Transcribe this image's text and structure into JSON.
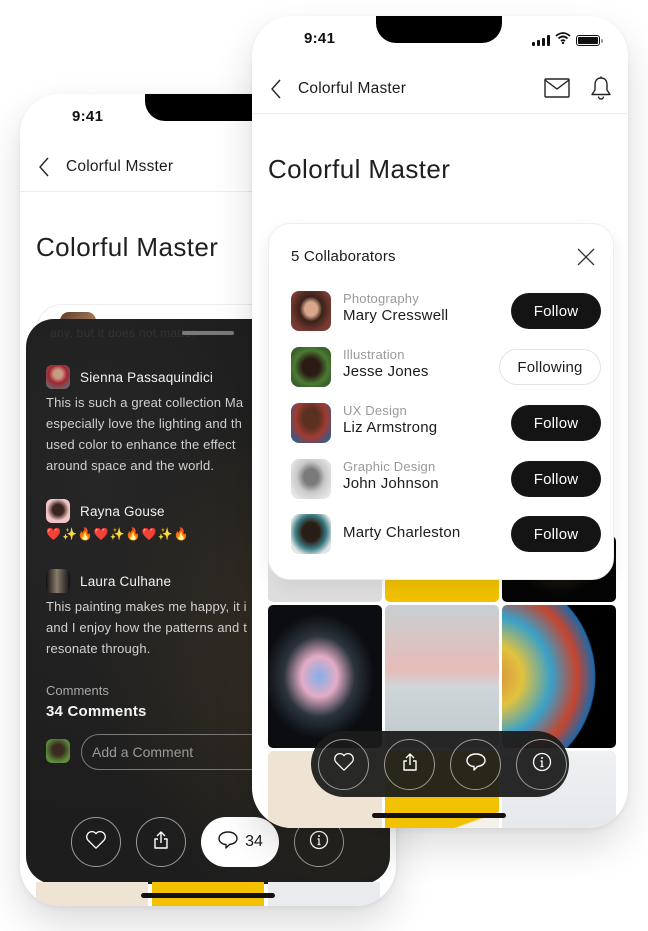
{
  "status_bar": {
    "time": "9:41",
    "signal_bars": 4,
    "battery_level": 1.0
  },
  "colors": {
    "accent": "#141414",
    "sheet_bg": "#1d1d1d",
    "muted_text": "#9a9a9a",
    "tile_yellow": "#f2c200"
  },
  "back_phone": {
    "nav_title": "Colorful Msster",
    "page_title": "Colorful Master",
    "faded_text": "any, but it does not matter",
    "comments": [
      {
        "author": "Sienna Passaquindici",
        "text": "This is such a great collection Ma\nespecially love the lighting and th\nused color to enhance the effect\naround space and the world."
      },
      {
        "author": "Rayna Gouse",
        "text": "❤️✨🔥❤️✨🔥❤️✨🔥"
      },
      {
        "author": "Laura Culhane",
        "text": "This painting makes me happy, it i\nand I enjoy how the patterns and t\nresonate through."
      }
    ],
    "comments_label": "Comments",
    "comments_count": "34 Comments",
    "comment_input_placeholder": "Add a Comment",
    "actions": {
      "like_icon": "heart-icon",
      "share_icon": "share-icon",
      "comment_icon": "comment-icon",
      "comment_count": "34",
      "info_icon": "info-icon"
    }
  },
  "front_phone": {
    "nav_title": "Colorful Master",
    "nav_icons": [
      "mail-icon",
      "bell-icon"
    ],
    "page_title": "Colorful Master",
    "collaborators_title": "5 Collaborators",
    "collaborators": [
      {
        "category": "Photography",
        "name": "Mary Cresswell",
        "button": "Follow",
        "state": "follow"
      },
      {
        "category": "Illustration",
        "name": "Jesse Jones",
        "button": "Following",
        "state": "following"
      },
      {
        "category": "UX Design",
        "name": "Liz Armstrong",
        "button": "Follow",
        "state": "follow"
      },
      {
        "category": "Graphic Design",
        "name": "John Johnson",
        "button": "Follow",
        "state": "follow"
      },
      {
        "category": "",
        "name": "Marty Charleston",
        "button": "Follow",
        "state": "follow"
      }
    ],
    "gallery_tiles": [
      "light-gray",
      "yellow",
      "dark-glow",
      "neon-flower",
      "pastel-dunes",
      "soap-bubble-planet",
      "beige-portrait",
      "yellow-book",
      "white-room"
    ],
    "actions": [
      "heart-icon",
      "share-icon",
      "comment-icon",
      "info-icon"
    ]
  }
}
